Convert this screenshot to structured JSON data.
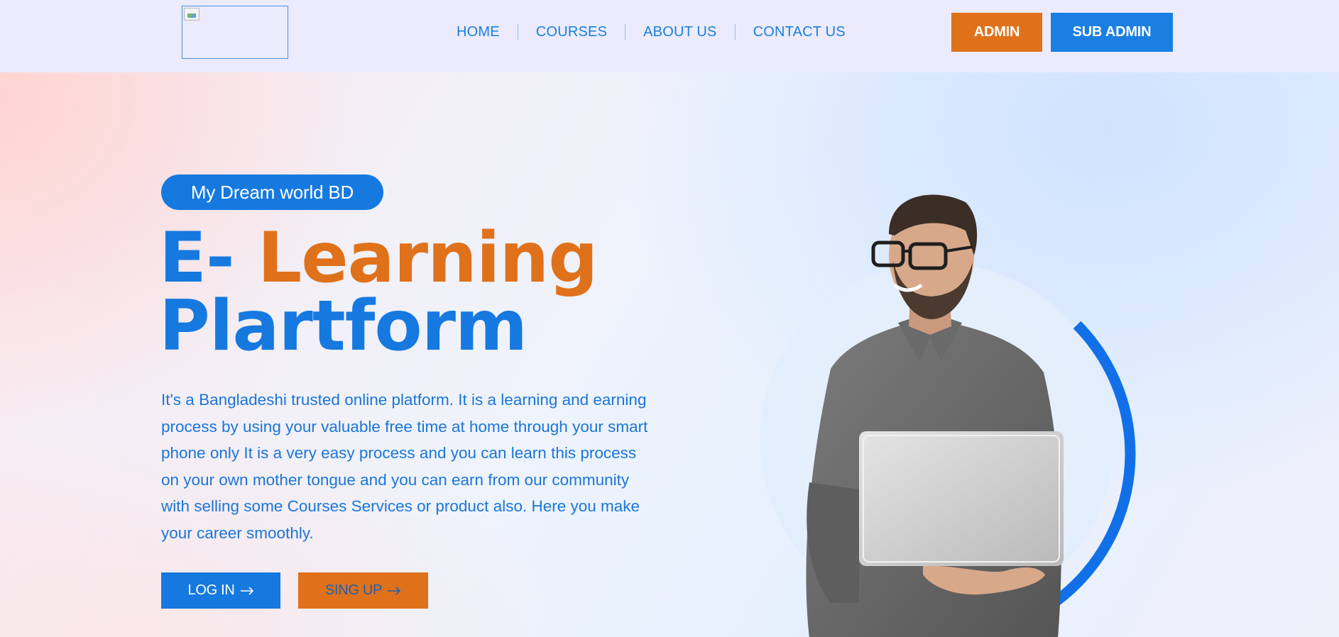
{
  "header": {
    "nav": [
      {
        "label": "HOME"
      },
      {
        "label": "COURSES"
      },
      {
        "label": "ABOUT US"
      },
      {
        "label": "CONTACT US"
      }
    ],
    "admin_label": "ADMIN",
    "sub_admin_label": "SUB ADMIN"
  },
  "hero": {
    "badge": "My Dream world BD",
    "title_part1": "E- ",
    "title_part2": "Learning",
    "title_part3": "Plartform",
    "description": "It's a Bangladeshi trusted online platform. It is a learning and earning process by using your valuable free time at home through your smart phone only It is a very easy process and you can learn this process on your own mother tongue and you can earn from our community with selling some Courses Services or product also. Here you make your career smoothly.",
    "login_label": "LOG IN",
    "signup_label": "SING UP",
    "arrow_icon": "arrow-right-icon"
  },
  "colors": {
    "brand_blue": "#1679e0",
    "brand_orange": "#e0711b",
    "header_bg": "#ebebfd"
  }
}
